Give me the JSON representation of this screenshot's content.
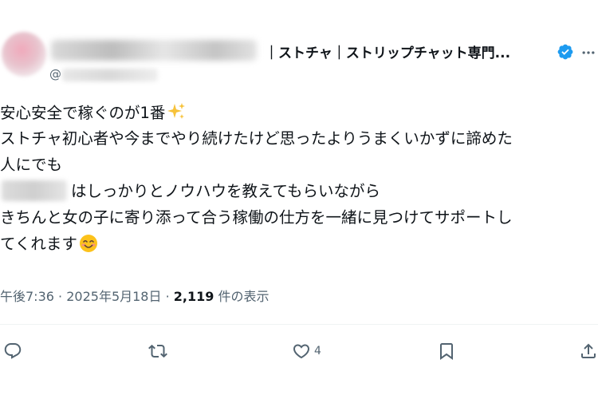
{
  "header": {
    "display_name_suffix": "｜ストチャ｜ストリップチャット専門...",
    "handle_prefix": "@"
  },
  "post": {
    "lines": [
      "安心安全で稼ぐのが1番",
      "ストチャ初心者や今までやり続けたけど思ったよりうまくいかずに諦めた",
      "人にでも",
      "はしっかりとノウハウを教えてもらいながら",
      "きちんと女の子に寄り添って合う稼働の仕方を一緒に見つけてサポートし",
      "てくれます"
    ],
    "emojis": [
      "sparkles-emoji",
      "smiling-face-emoji"
    ]
  },
  "meta": {
    "time": "午後7:36",
    "separator": "·",
    "date": "2025年5月18日",
    "views_count": "2,119",
    "views_label": "件の表示"
  },
  "actions": {
    "reply_count": "",
    "repost_count": "",
    "like_count": "4",
    "bookmark_count": "",
    "icons": [
      "reply-icon",
      "repost-icon",
      "like-icon",
      "bookmark-icon",
      "share-icon"
    ]
  },
  "colors": {
    "text": "#0f1419",
    "muted": "#536471",
    "verified": "#1d9bf0",
    "background": "#ffffff"
  }
}
